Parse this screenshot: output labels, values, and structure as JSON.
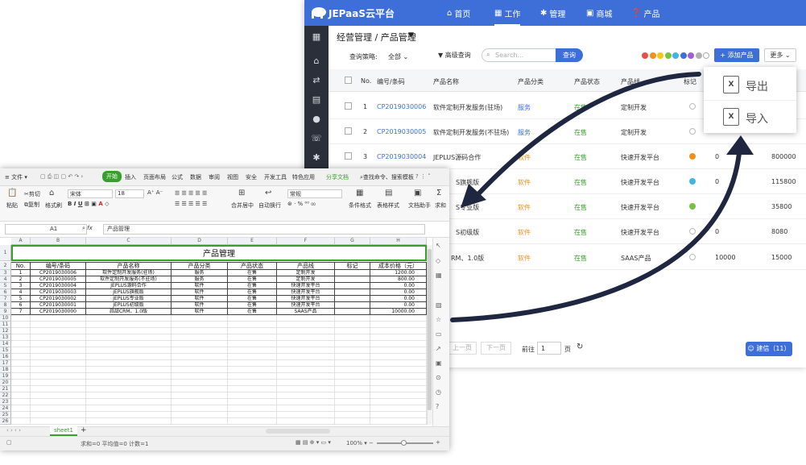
{
  "jepaas": {
    "app_title": "JEPaaS云平台",
    "nav": [
      {
        "icon": "home-icon",
        "glyph": "⌂",
        "label": "首页"
      },
      {
        "icon": "grid-icon",
        "glyph": "▦",
        "label": "工作"
      },
      {
        "icon": "gear-icon",
        "glyph": "✱",
        "label": "管理"
      },
      {
        "icon": "store-icon",
        "glyph": "▣",
        "label": "商城"
      },
      {
        "icon": "help-icon",
        "glyph": "?",
        "label": "产品"
      }
    ],
    "breadcrumb": "经营管理 / 产品管理",
    "query_label": "查询策略:",
    "query_value": "全部",
    "advanced_query": "高级查询",
    "search_placeholder": "Search...",
    "search_button": "查询",
    "add_button": "+ 添加产品",
    "more_button": "更多",
    "color_dots": [
      "#e84d4d",
      "#f0901d",
      "#f5c518",
      "#7ac143",
      "#3db5e6",
      "#3e6fd8",
      "#a35cd6",
      "#b0b0b0",
      "#ffffff"
    ],
    "columns": [
      "No.",
      "编号/条码",
      "产品名称",
      "产品分类",
      "产品状态",
      "产品线",
      "标记"
    ],
    "rows": [
      {
        "no": "1",
        "code": "CP2019030006",
        "name": "软件定制开发服务(驻场)",
        "cat": "服务",
        "status": "在售",
        "line": "定制开发",
        "mark": "",
        "n1": "",
        "n2": ""
      },
      {
        "no": "2",
        "code": "CP2019030005",
        "name": "软件定制开发服务(不驻场)",
        "cat": "服务",
        "status": "在售",
        "line": "定制开发",
        "mark": "",
        "n1": "",
        "n2": ""
      },
      {
        "no": "3",
        "code": "CP2019030004",
        "name": "JEPLUS源码合作",
        "cat": "软件",
        "status": "在售",
        "line": "快速开发平台",
        "mark": "#f0901d",
        "n1": "0",
        "n2": "800000"
      },
      {
        "no": "",
        "code": "",
        "name": "S旗舰版",
        "cat": "软件",
        "status": "在售",
        "line": "快速开发平台",
        "mark": "#3db5e6",
        "n1": "0",
        "n2": "115800"
      },
      {
        "no": "",
        "code": "",
        "name": "S专业版",
        "cat": "软件",
        "status": "在售",
        "line": "快速开发平台",
        "mark": "#7ac143",
        "n1": "",
        "n2": "35800"
      },
      {
        "no": "",
        "code": "",
        "name": "S初级版",
        "cat": "软件",
        "status": "在售",
        "line": "快速开发平台",
        "mark": "",
        "n1": "0",
        "n2": "8080"
      },
      {
        "no": "",
        "code": "",
        "name": "RM、1.0版",
        "cat": "软件",
        "status": "在售",
        "line": "SAAS产品",
        "mark": "",
        "n1": "10000",
        "n2": "15000"
      }
    ],
    "pager": {
      "prev": "上一页",
      "next": "下一页",
      "goto": "前往",
      "page": "1",
      "unit": "页"
    },
    "feedback_button": "建信（11）",
    "dropdown": [
      {
        "label": "导出",
        "icon": "excel-export-icon"
      },
      {
        "label": "导入",
        "icon": "excel-import-icon"
      }
    ]
  },
  "excel": {
    "menu": [
      "≡ 文件 ▾",
      "开始",
      "插入",
      "页面布局",
      "公式",
      "数据",
      "审阅",
      "视图",
      "安全",
      "开发工具",
      "特色应用",
      "分享文档",
      "查找命令、搜索模板"
    ],
    "toolbar": {
      "paste": "粘贴",
      "cut": "剪切",
      "copy": "复制",
      "format_painter": "格式刷",
      "font": "宋体",
      "font_size": "18",
      "merge": "合并居中",
      "wrap": "自动换行",
      "number_format": "常规",
      "cond_format": "条件格式",
      "table_style": "表格样式",
      "doc_helper": "文档助手",
      "sum": "求和"
    },
    "cell_ref": "A1",
    "formula": "产品管理",
    "col_letters": [
      "A",
      "B",
      "C",
      "D",
      "E",
      "F",
      "G",
      "H"
    ],
    "sheet_title": "产品管理",
    "headers": [
      "No.",
      "编号/条码",
      "产品名称",
      "产品分类",
      "产品状态",
      "产品线",
      "标记",
      "成本价格（元）"
    ],
    "rows": [
      [
        "1",
        "CP2019030006",
        "软件定制开发服务(驻场)",
        "服务",
        "在售",
        "定制开发",
        "",
        "1200.00"
      ],
      [
        "2",
        "CP2019030005",
        "软件定制开发服务(不驻场)",
        "服务",
        "在售",
        "定制开发",
        "",
        "800.00"
      ],
      [
        "3",
        "CP2019030004",
        "JEPLUS源码合作",
        "软件",
        "在售",
        "快速开发平台",
        "",
        "0.00"
      ],
      [
        "4",
        "CP2019030003",
        "JEPLUS旗舰版",
        "软件",
        "在售",
        "快速开发平台",
        "",
        "0.00"
      ],
      [
        "5",
        "CP2019030002",
        "JEPLUS专业版",
        "软件",
        "在售",
        "快速开发平台",
        "",
        "0.00"
      ],
      [
        "6",
        "CP2019030001",
        "JEPLUS初级版",
        "软件",
        "在售",
        "快速开发平台",
        "",
        "0.00"
      ],
      [
        "7",
        "CP2019030000",
        "蒜甜CRM、1.0版",
        "软件",
        "在售",
        "SAAS产品",
        "",
        "10000.00"
      ]
    ],
    "sheet_tab": "sheet1",
    "status": "求和=0  平均值=0  计数=1",
    "zoom": "100%"
  }
}
